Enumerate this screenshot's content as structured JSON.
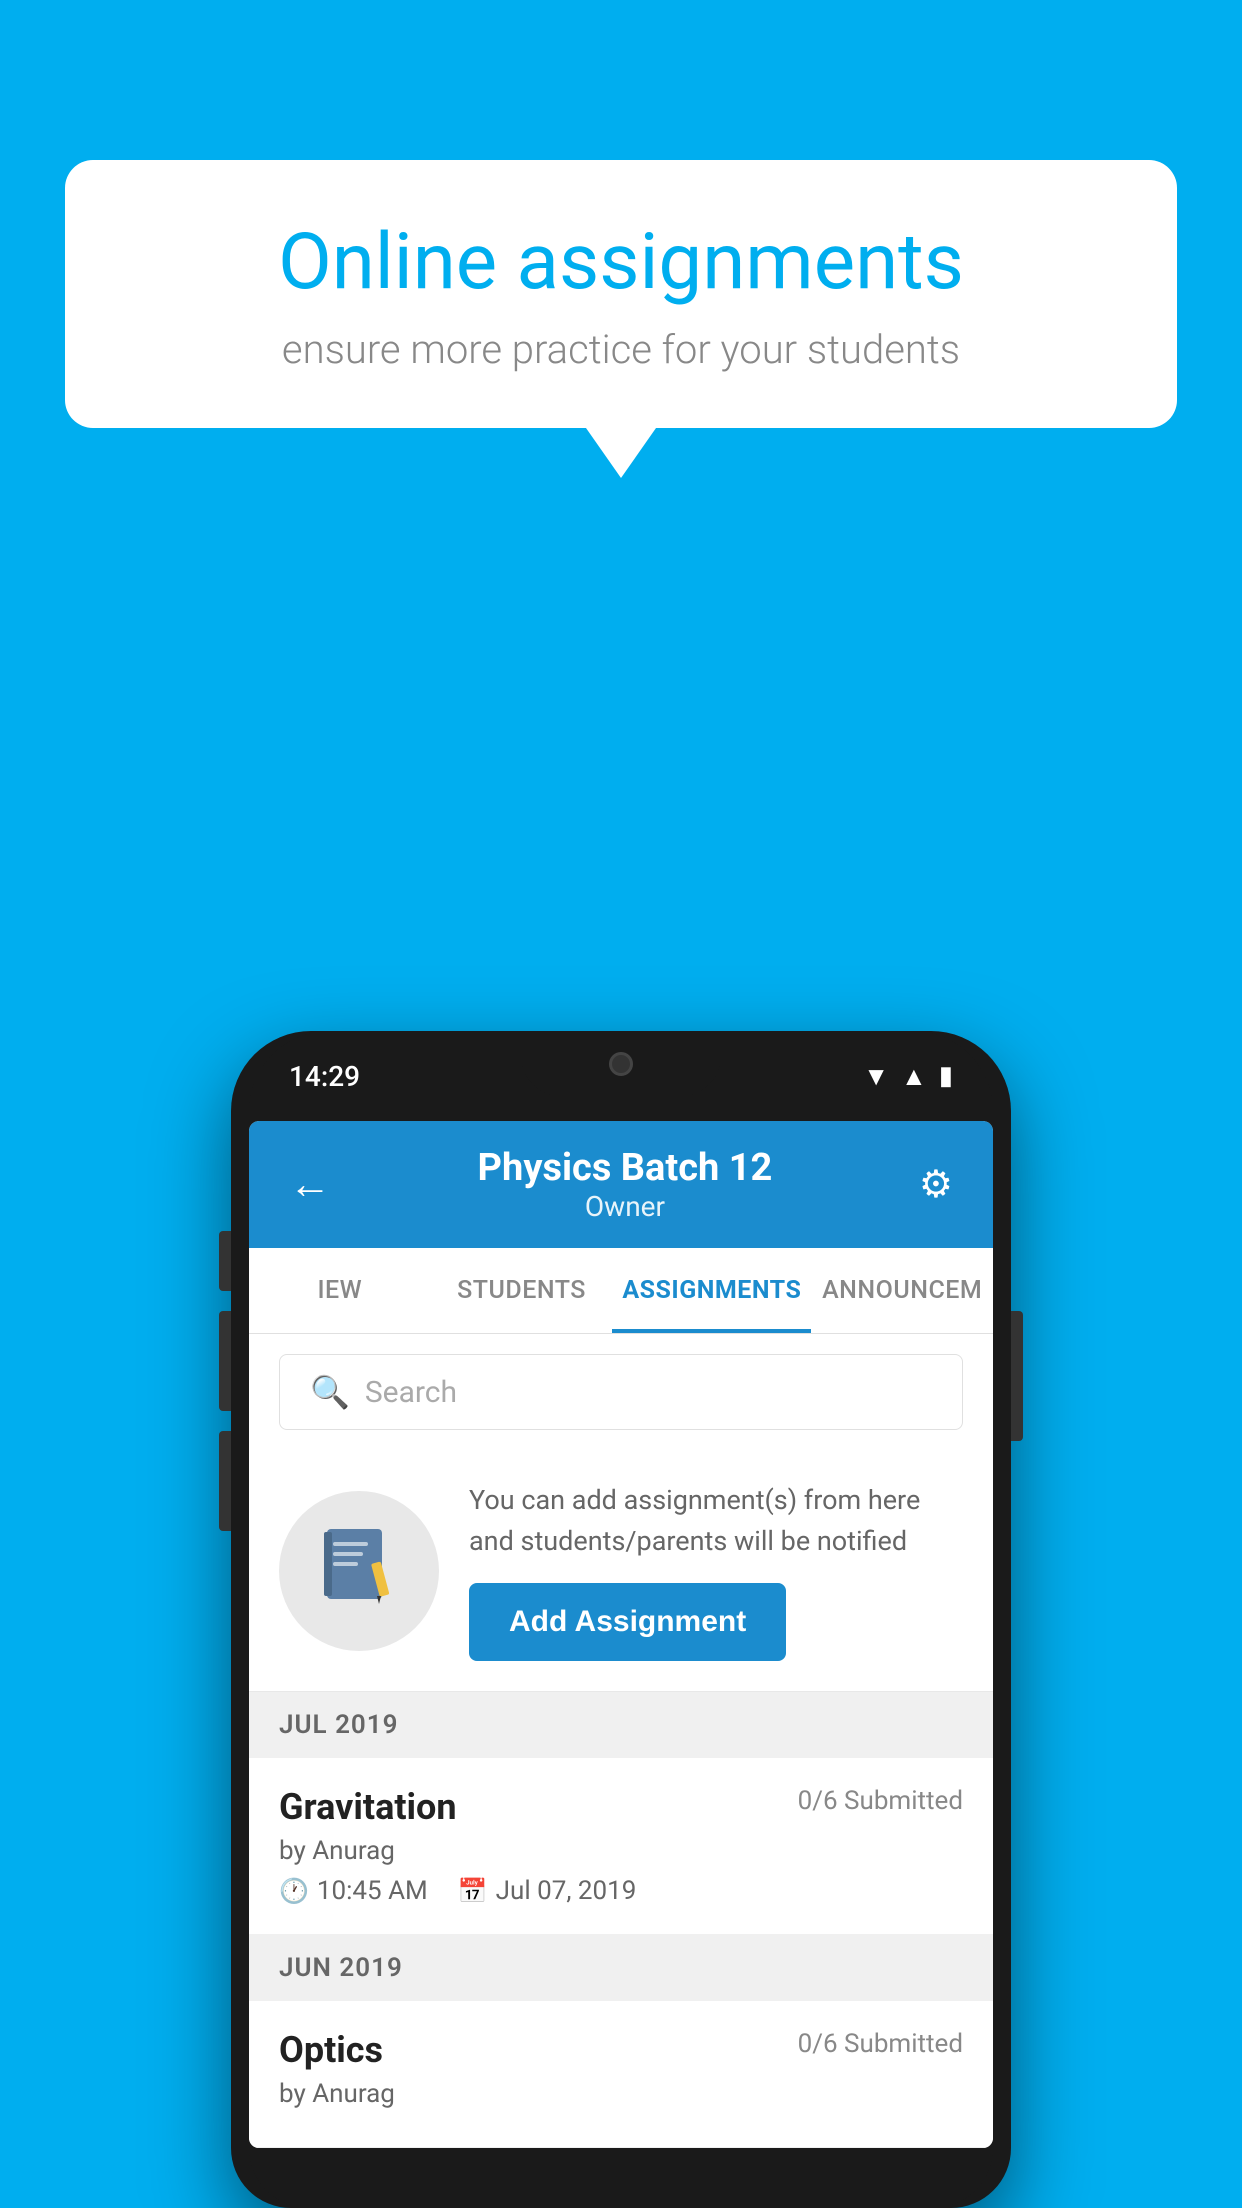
{
  "background_color": "#00AEEF",
  "speech_bubble": {
    "title": "Online assignments",
    "subtitle": "ensure more practice for your students"
  },
  "phone": {
    "status_bar": {
      "time": "14:29",
      "icons": [
        "wifi",
        "signal",
        "battery"
      ]
    },
    "header": {
      "back_label": "←",
      "title": "Physics Batch 12",
      "subtitle": "Owner",
      "settings_label": "⚙"
    },
    "tabs": [
      {
        "label": "IEW",
        "active": false
      },
      {
        "label": "STUDENTS",
        "active": false
      },
      {
        "label": "ASSIGNMENTS",
        "active": true
      },
      {
        "label": "ANNOUNCEM",
        "active": false
      }
    ],
    "search": {
      "placeholder": "Search"
    },
    "add_assignment": {
      "description": "You can add assignment(s) from here and students/parents will be notified",
      "button_label": "Add Assignment"
    },
    "sections": [
      {
        "month": "JUL 2019",
        "assignments": [
          {
            "name": "Gravitation",
            "submitted": "0/6 Submitted",
            "by": "by Anurag",
            "time": "10:45 AM",
            "date": "Jul 07, 2019"
          }
        ]
      },
      {
        "month": "JUN 2019",
        "assignments": [
          {
            "name": "Optics",
            "submitted": "0/6 Submitted",
            "by": "by Anurag",
            "time": "",
            "date": ""
          }
        ]
      }
    ]
  }
}
